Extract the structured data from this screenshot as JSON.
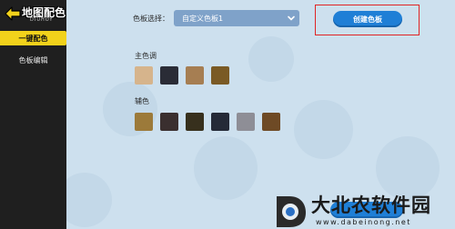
{
  "sidebar": {
    "logo_text": "地图配色",
    "logo_sub": "DIUHOY",
    "items": [
      {
        "label": "一键配色",
        "active": true
      },
      {
        "label": "色板编辑",
        "active": false
      }
    ]
  },
  "main": {
    "palette_select_label": "色板选择：",
    "palette_select_value": "自定义色板1",
    "create_button_label": "创建色板",
    "primary_label": "主色调",
    "secondary_label": "辅色",
    "primary_colors": [
      "#d6b48c",
      "#2a2c36",
      "#a67e52",
      "#7a5a25"
    ],
    "secondary_colors": [
      "#9c7a3a",
      "#3a2f2f",
      "#37301d",
      "#252a37",
      "#8e8e96",
      "#6e4a25"
    ]
  },
  "watermark": {
    "name": "大北农软件园",
    "domain": "www.dabeinong.net"
  },
  "colors": {
    "sidebar_bg": "#1f1f1f",
    "active_nav": "#f2d21b",
    "select_bg": "#7fa2c9",
    "button_blue": "#1f7fd6",
    "highlight_red": "#e02424"
  }
}
